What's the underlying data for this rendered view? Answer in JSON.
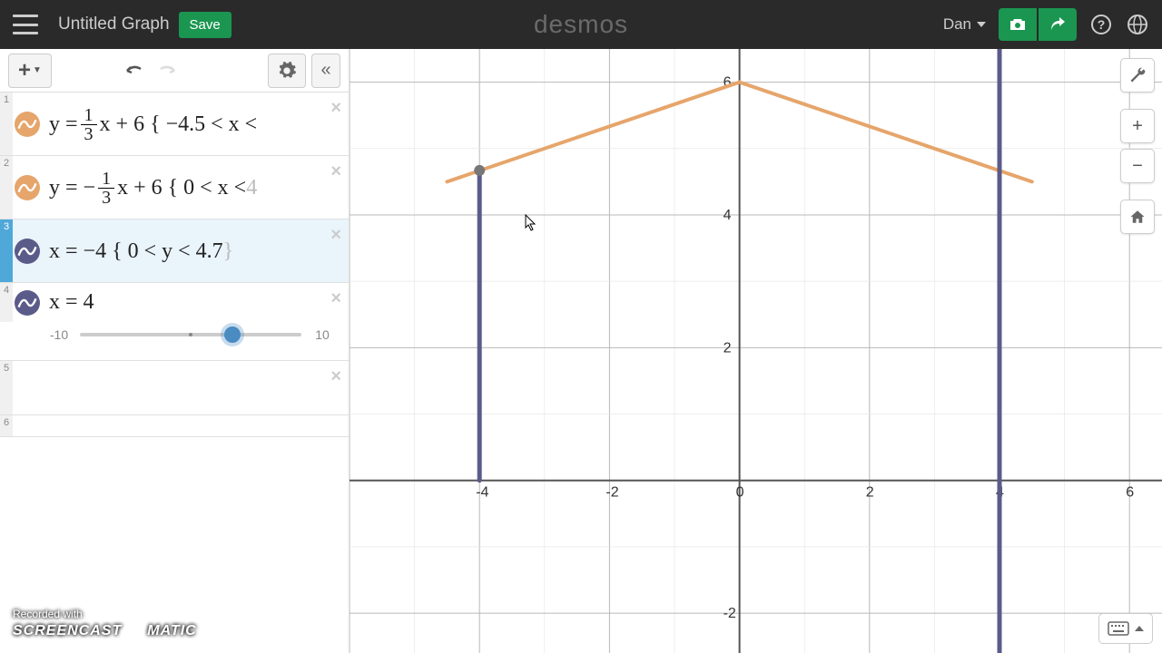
{
  "header": {
    "title_placeholder": "Untitled Graph",
    "save_label": "Save",
    "logo_text": "desmos",
    "user_name": "Dan"
  },
  "toolbar": {
    "add_label": "+"
  },
  "expressions": [
    {
      "index": "1",
      "color": "#e6a56b",
      "latex_prefix": "y = ",
      "frac_top": "1",
      "frac_bot": "3",
      "latex_mid": "x + 6 { −4.5 < x <"
    },
    {
      "index": "2",
      "color": "#e6a56b",
      "latex_prefix": "y = − ",
      "frac_top": "1",
      "frac_bot": "3",
      "latex_mid": "x + 6 { 0 < x < ",
      "latex_faded": "4"
    },
    {
      "index": "3",
      "color": "#5b5b8a",
      "latex_plain": "x = −4 { 0 < y < 4.7 ",
      "latex_faded": "}",
      "selected": true
    },
    {
      "index": "4",
      "color": "#5b5b8a",
      "latex_plain": "x = 4",
      "slider": {
        "min": "-10",
        "max": "10",
        "value_pct": 69
      }
    },
    {
      "index": "5"
    },
    {
      "index": "6"
    }
  ],
  "axis_labels": {
    "x_ticks": [
      "-4",
      "-2",
      "0",
      "2",
      "4",
      "6"
    ],
    "y_ticks": [
      "6",
      "4",
      "2",
      "-2"
    ]
  },
  "chart_data": {
    "type": "line",
    "xlim": [
      -6,
      6.5
    ],
    "ylim": [
      -2.6,
      6.5
    ],
    "grid": true,
    "series": [
      {
        "name": "y=⅓x+6 {-4.5<x<0}",
        "color": "#e6a56b",
        "points": [
          [
            -4.5,
            4.5
          ],
          [
            0,
            6
          ]
        ]
      },
      {
        "name": "y=-⅓x+6 {0<x<4.5}",
        "color": "#e6a56b",
        "points": [
          [
            0,
            6
          ],
          [
            4.5,
            4.5
          ]
        ]
      },
      {
        "name": "x=-4 {0<y<4.7}",
        "color": "#5b5b8a",
        "points": [
          [
            -4,
            0
          ],
          [
            -4,
            4.7
          ]
        ]
      },
      {
        "name": "x=4 (full)",
        "color": "#5b5b8a",
        "points": [
          [
            4,
            -2.6
          ],
          [
            4,
            6.5
          ]
        ]
      }
    ],
    "highlight_point": [
      -4,
      4.67
    ]
  },
  "watermark": {
    "line1": "Recorded with",
    "line2a": "SCREENCAST",
    "line2b": "MATIC"
  }
}
